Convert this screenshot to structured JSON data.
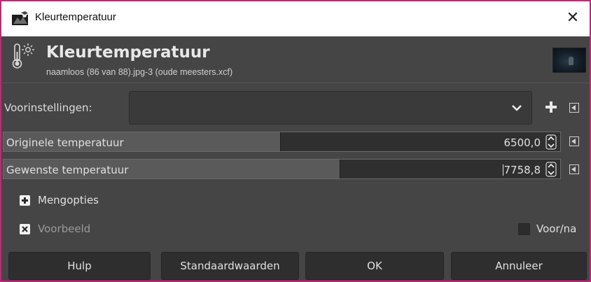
{
  "window": {
    "title": "Kleurtemperatuur",
    "close_glyph": "✕",
    "accent_border": "#c8237a"
  },
  "header": {
    "title": "Kleurtemperatuur",
    "subtitle": "naamloos (86 van 88).jpg-3 (oude meesters.xcf)",
    "icon": "thermometer-sun-icon"
  },
  "presets": {
    "label": "Voorinstellingen:",
    "value": ""
  },
  "sliders": [
    {
      "label": "Originele temperatuur",
      "value": "6500,0",
      "fill_fraction": 0.5
    },
    {
      "label": "Gewenste temperatuur",
      "value": "7758,8",
      "fill_fraction": 0.605
    }
  ],
  "expander": {
    "label": "Mengopties"
  },
  "preview": {
    "label": "Voorbeeld",
    "checked": true
  },
  "before_after": {
    "label": "Voor/na",
    "checked": false
  },
  "buttons": {
    "help": "Hulp",
    "reset": "Standaardwaarden",
    "ok": "OK",
    "cancel": "Annuleer"
  }
}
